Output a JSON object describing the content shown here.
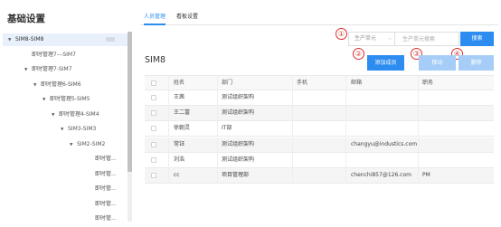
{
  "page_title": "基础设置",
  "tabs": [
    {
      "label": "人员管理",
      "active": true
    },
    {
      "label": "看板设置",
      "active": false
    }
  ],
  "tree": [
    {
      "label": "SIM8-SIM8",
      "indent": 0,
      "has_arrow": true,
      "selected": true
    },
    {
      "label": "即时管理7---SIM7",
      "indent": 1,
      "has_arrow": false
    },
    {
      "label": "即时管理7-SIM7",
      "indent": 1,
      "has_arrow": true
    },
    {
      "label": "即时管理6-SIM6",
      "indent": 2,
      "has_arrow": true
    },
    {
      "label": "即时管理5-SIM5",
      "indent": 3,
      "has_arrow": true
    },
    {
      "label": "即时管理4-SIM4",
      "indent": 4,
      "has_arrow": true
    },
    {
      "label": "SIM3-SIM3",
      "indent": 5,
      "has_arrow": true
    },
    {
      "label": "SIM2-SIM2",
      "indent": 6,
      "has_arrow": true
    },
    {
      "label": "即时管...",
      "indent": 8,
      "has_arrow": false
    },
    {
      "label": "即时管...",
      "indent": 8,
      "has_arrow": false
    },
    {
      "label": "即时管...",
      "indent": 8,
      "has_arrow": false
    },
    {
      "label": "即时管...",
      "indent": 8,
      "has_arrow": false
    },
    {
      "label": "即时管...",
      "indent": 8,
      "has_arrow": false
    }
  ],
  "search": {
    "select_value": "生产单元",
    "placeholder": "生产单元搜索",
    "search_label": "搜索"
  },
  "section_title": "SIM8",
  "actions": {
    "add_label": "添加成员",
    "move_label": "移动",
    "delete_label": "删除"
  },
  "badges": [
    "①",
    "②",
    "③",
    "④"
  ],
  "table": {
    "columns": [
      "姓名",
      "部门",
      "手机",
      "邮箱",
      "职务"
    ],
    "rows": [
      [
        "王茜",
        "测试组织架构",
        "",
        "",
        ""
      ],
      [
        "王二富",
        "测试组织架构",
        "",
        "",
        ""
      ],
      [
        "徐朝灵",
        "IT部",
        "",
        "",
        ""
      ],
      [
        "常钰",
        "测试组织架构",
        "",
        "changyu@industics.com",
        ""
      ],
      [
        "刘浩",
        "测试组织架构",
        "",
        "",
        ""
      ],
      [
        "cc",
        "项目管理部",
        "",
        "chenchi857@126.com",
        "PM"
      ]
    ]
  },
  "colors": {
    "primary": "#2d8cf0",
    "disabled": "#a5cdf7",
    "badge": "#d9302c",
    "selected_bg": "#e8f1fb"
  }
}
